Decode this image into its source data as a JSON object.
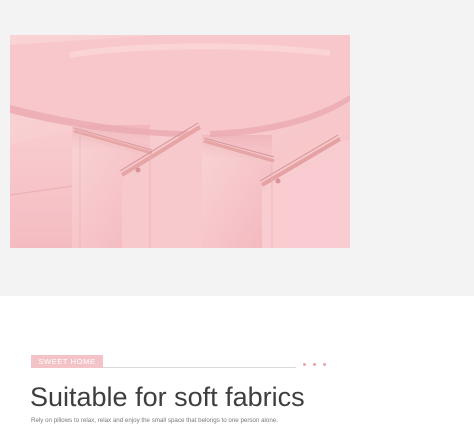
{
  "product_image": {
    "subject": "pink-laundry-bags",
    "colors": {
      "fabric": "#f7c6ca",
      "zipper": "#e8a9a5",
      "panel_background": "#f3f3f3"
    }
  },
  "section": {
    "tag": "SWEET HOME",
    "title": "Suitable for soft fabrics",
    "caption": "Rely on pillows to relax, relax and enjoy the small space that belongs to one person alone."
  },
  "colors": {
    "accent": "#f4c3c8",
    "title_text": "#3e3e3e"
  }
}
